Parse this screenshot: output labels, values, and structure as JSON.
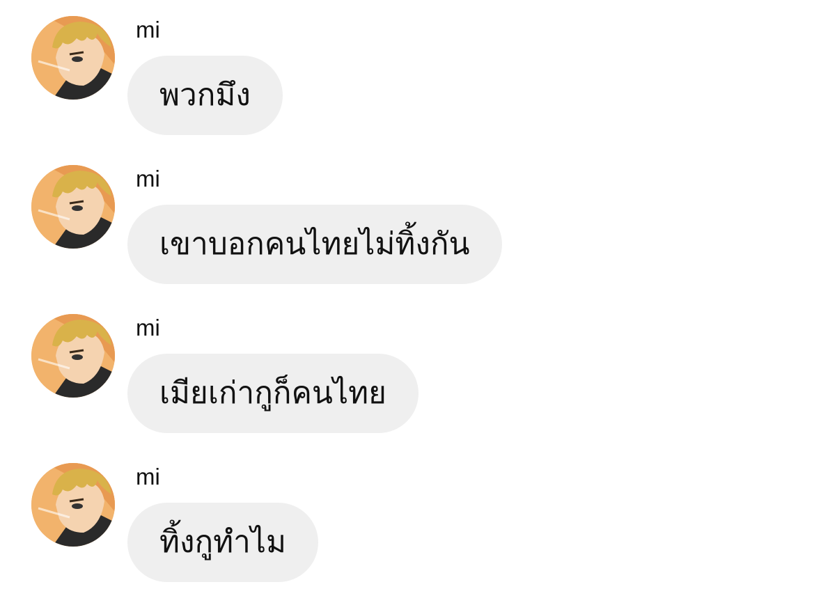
{
  "chat": {
    "messages": [
      {
        "sender": "mi",
        "text": "พวกมึง",
        "avatar_icon": "anime-character-avatar-icon"
      },
      {
        "sender": "mi",
        "text": "เขาบอกคนไทยไม่ทิ้งกัน",
        "avatar_icon": "anime-character-avatar-icon"
      },
      {
        "sender": "mi",
        "text": "เมียเก่ากูก็คนไทย",
        "avatar_icon": "anime-character-avatar-icon"
      },
      {
        "sender": "mi",
        "text": "ทิ้งกูทำไม",
        "avatar_icon": "anime-character-avatar-icon"
      }
    ]
  },
  "colors": {
    "bubble_background": "#efefef",
    "text": "#111111",
    "page_background": "#ffffff",
    "avatar_background": "#f2b36c"
  }
}
